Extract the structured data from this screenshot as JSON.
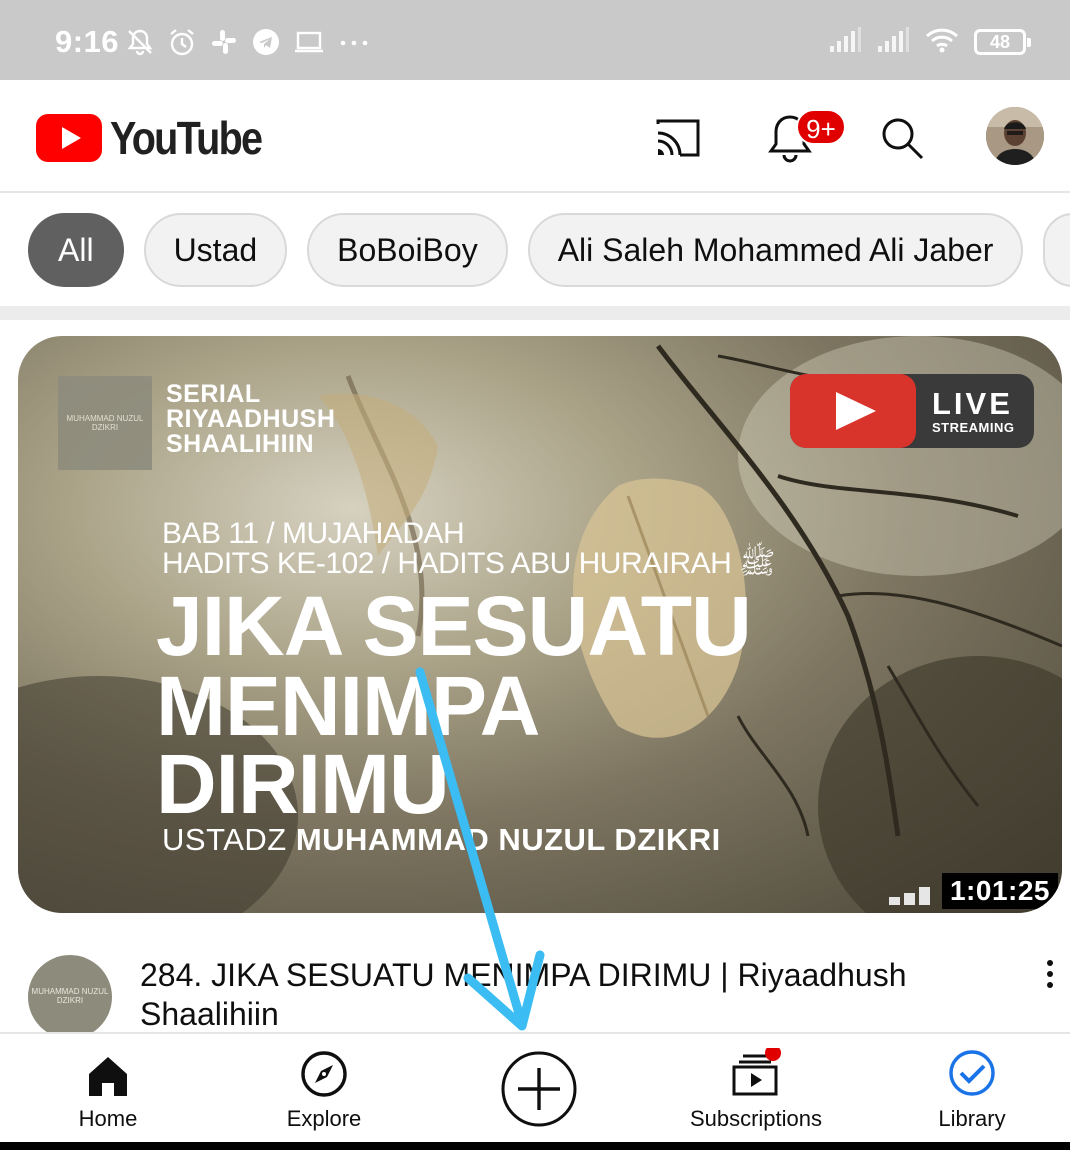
{
  "status_bar": {
    "time": "9:16",
    "battery": "48",
    "icons": [
      "mute-icon",
      "alarm-icon",
      "slack-icon",
      "telegram-icon",
      "laptop-icon",
      "more-dots-icon",
      "signal-icon",
      "signal-icon",
      "wifi-icon",
      "battery-icon"
    ]
  },
  "app_bar": {
    "brand": "YouTube",
    "notification_badge": "9+",
    "icons": [
      "cast-icon",
      "bell-icon",
      "search-icon",
      "account-avatar"
    ]
  },
  "chips": [
    "All",
    "Ustad",
    "BoBoiBoy",
    "Ali Saleh Mohammed Ali Jaber"
  ],
  "active_chip": "All",
  "video": {
    "thumbnail": {
      "logo_text": "MUHAMMAD NUZUL DZIKRI",
      "serial_line1": "SERIAL",
      "serial_line2": "RIYAADHUSH",
      "serial_line3": "SHAALIHIIN",
      "live_word": "LIVE",
      "live_sub": "STREAMING",
      "sub_line1": "BAB 11 / MUJAHADAH",
      "sub_line2": "HADITS KE-102 / HADITS ABU HURAIRAH ﷺ",
      "big_line1": "JIKA SESUATU",
      "big_line2": "MENIMPA",
      "big_line3": "DIRIMU",
      "author_prefix": "USTADZ ",
      "author_name": "MUHAMMAD NUZUL DZIKRI"
    },
    "duration": "1:01:25",
    "channel_avatar_text": "MUHAMMAD NUZUL DZIKRI",
    "title_line1": "284. JIKA SESUATU MENIMPA DIRIMU | Riyaadhush",
    "title_line2": "Shaalihiin"
  },
  "bottom_nav": {
    "home": "Home",
    "explore": "Explore",
    "subscriptions": "Subscriptions",
    "library": "Library"
  },
  "colors": {
    "brand_red": "#ff0000",
    "badge_red": "#e00000",
    "annotation_arrow": "#3bbcf2",
    "library_blue": "#1a73e8"
  }
}
